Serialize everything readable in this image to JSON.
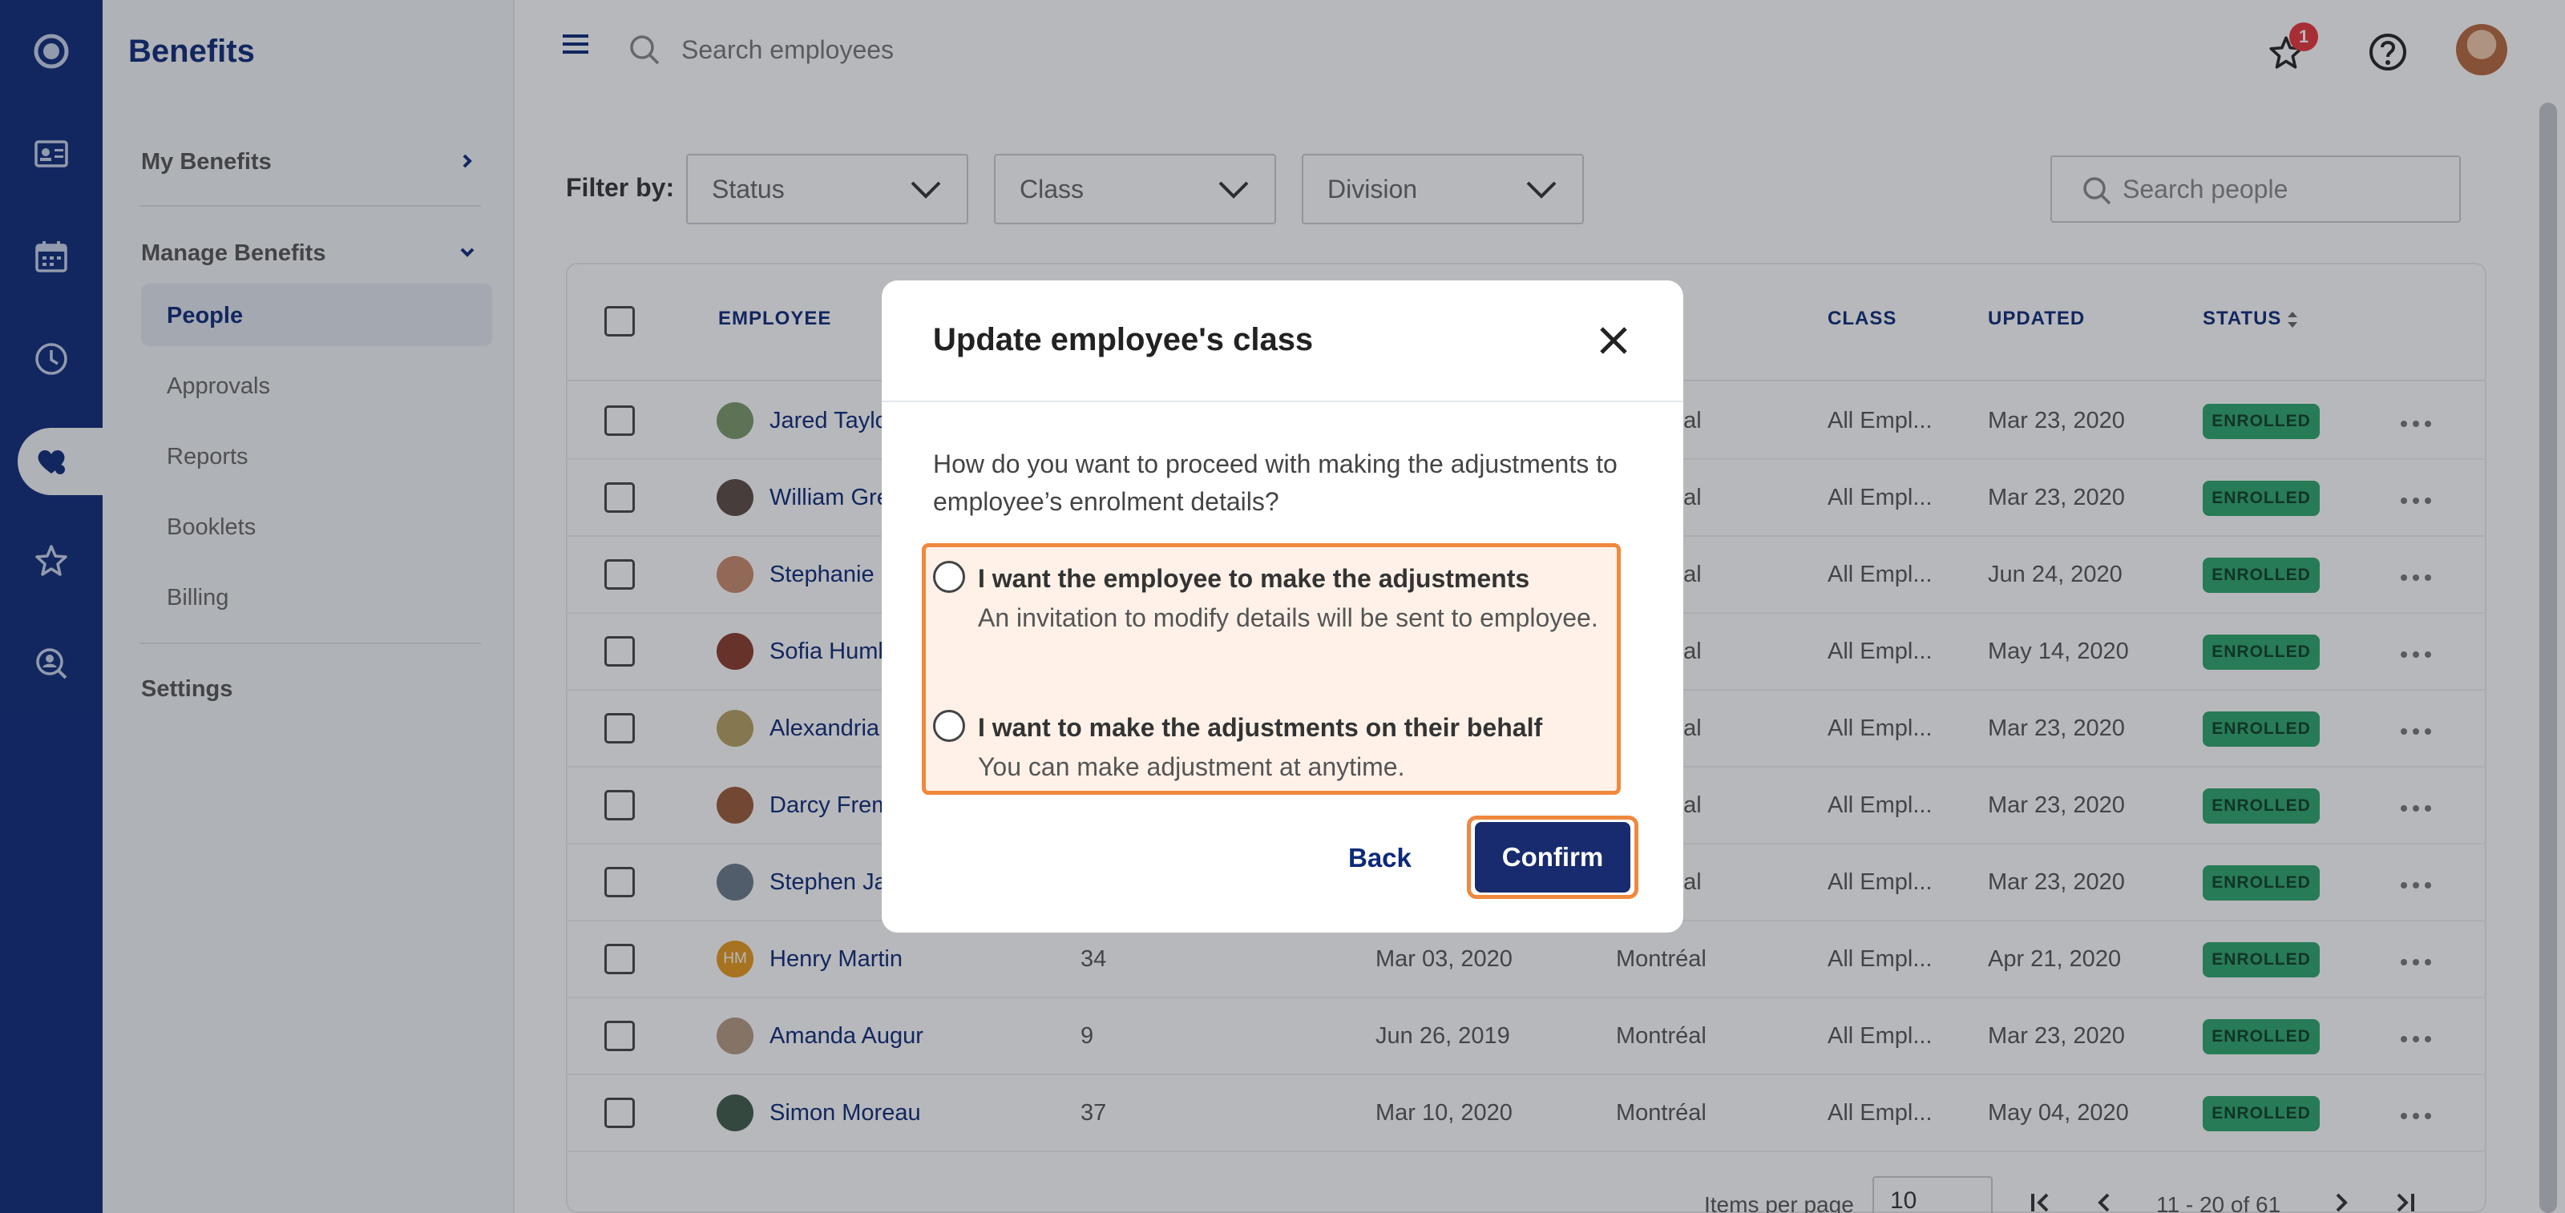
{
  "app": {
    "title": "Benefits"
  },
  "sidebar": {
    "my_benefits": "My Benefits",
    "manage_benefits": "Manage Benefits",
    "items": [
      {
        "label": "People",
        "active": true
      },
      {
        "label": "Approvals"
      },
      {
        "label": "Reports"
      },
      {
        "label": "Booklets"
      },
      {
        "label": "Billing"
      }
    ],
    "settings": "Settings"
  },
  "rail_icons": [
    "logo-icon",
    "id-card-icon",
    "calendar-icon",
    "clock-icon",
    "heart-hand-icon",
    "star-icon",
    "search-person-icon"
  ],
  "topbar": {
    "search_placeholder": "Search employees",
    "notification_count": "1"
  },
  "filters": {
    "label": "Filter by:",
    "status": "Status",
    "class": "Class",
    "division": "Division",
    "search_placeholder": "Search people"
  },
  "table": {
    "headers": {
      "employee": "EMPLOYEE",
      "division": "ON",
      "class": "CLASS",
      "updated": "UPDATED",
      "status": "STATUS"
    },
    "rows": [
      {
        "name": "Jared Taylo",
        "num": "",
        "date": "",
        "division": "éal",
        "class": "All Empl...",
        "updated": "Mar 23, 2020",
        "status": "ENROLLED",
        "avatar": "#7d9a6a"
      },
      {
        "name": "William Gre",
        "num": "",
        "date": "",
        "division": "éal",
        "class": "All Empl...",
        "updated": "Mar 23, 2020",
        "status": "ENROLLED",
        "avatar": "#5a4a42"
      },
      {
        "name": "Stephanie",
        "num": "",
        "date": "",
        "division": "éal",
        "class": "All Empl...",
        "updated": "Jun 24, 2020",
        "status": "ENROLLED",
        "avatar": "#c98a6a"
      },
      {
        "name": "Sofia Huml",
        "num": "",
        "date": "",
        "division": "éal",
        "class": "All Empl...",
        "updated": "May 14, 2020",
        "status": "ENROLLED",
        "avatar": "#8a3a2a"
      },
      {
        "name": "Alexandria",
        "num": "",
        "date": "",
        "division": "éal",
        "class": "All Empl...",
        "updated": "Mar 23, 2020",
        "status": "ENROLLED",
        "avatar": "#b6a060"
      },
      {
        "name": "Darcy Frem",
        "num": "",
        "date": "",
        "division": "éal",
        "class": "All Empl...",
        "updated": "Mar 23, 2020",
        "status": "ENROLLED",
        "avatar": "#9a5a3a"
      },
      {
        "name": "Stephen Ja",
        "num": "",
        "date": "",
        "division": "éal",
        "class": "All Empl...",
        "updated": "Mar 23, 2020",
        "status": "ENROLLED",
        "avatar": "#6a7a8a"
      },
      {
        "name": "Henry Martin",
        "num": "34",
        "date": "Mar 03, 2020",
        "division": "Montréal",
        "class": "All Empl...",
        "updated": "Apr 21, 2020",
        "status": "ENROLLED",
        "avatar": "#e79a1c",
        "initials": "HM"
      },
      {
        "name": "Amanda Augur",
        "num": "9",
        "date": "Jun 26, 2019",
        "division": "Montréal",
        "class": "All Empl...",
        "updated": "Mar 23, 2020",
        "status": "ENROLLED",
        "avatar": "#b59a82"
      },
      {
        "name": "Simon Moreau",
        "num": "37",
        "date": "Mar 10, 2020",
        "division": "Montréal",
        "class": "All Empl...",
        "updated": "May 04, 2020",
        "status": "ENROLLED",
        "avatar": "#3e5a4a"
      }
    ],
    "footer": {
      "items_per_page_label": "Items per page",
      "items_per_page": "10",
      "range": "11 - 20 of 61"
    }
  },
  "modal": {
    "title": "Update employee's class",
    "question": "How do you want to proceed with making the adjustments to employee’s enrolment details?",
    "options": [
      {
        "title": "I want the employee to make the adjustments",
        "desc": "An invitation to modify details will be sent to employee."
      },
      {
        "title": "I want to make the adjustments on their behalf",
        "desc": "You can make adjustment at anytime."
      }
    ],
    "back": "Back",
    "confirm": "Confirm"
  },
  "colors": {
    "brand": "#0d2a7a",
    "enrolled": "#2ca56b",
    "highlight": "#f0883e",
    "confirm": "#182b6f"
  }
}
